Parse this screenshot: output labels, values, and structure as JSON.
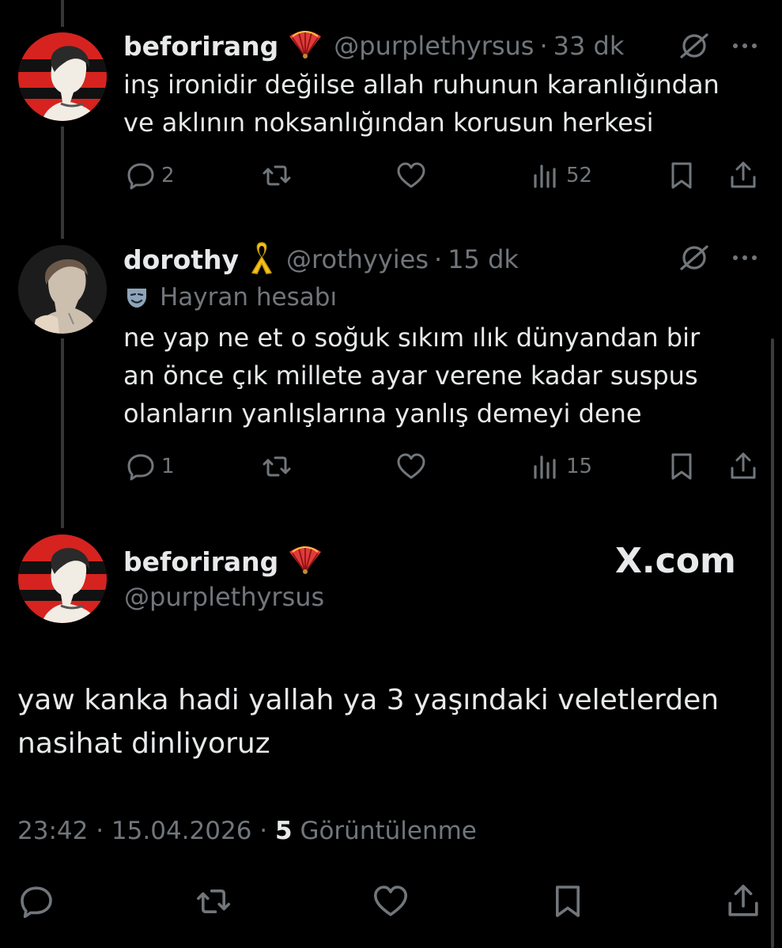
{
  "reply1": {
    "display_name": "beforirang",
    "emoji_icon": "folding-fan-icon",
    "handle": "@purplethyrsus",
    "separator": "·",
    "time": "33 dk",
    "text": "inş ironidir değilse allah ruhunun karanlığından\nve aklının noksanlığından korusun herkesi",
    "replies": "2",
    "views": "52"
  },
  "reply2": {
    "display_name": "dorothy",
    "emoji_icon": "yellow-ribbon-icon",
    "handle": "@rothyyies",
    "separator": "·",
    "time": "15 dk",
    "label_icon": "theater-mask-icon",
    "label": "Hayran hesabı",
    "text": "ne yap ne et o soğuk sıkım ılık dünyandan bir\nan önce çık millete ayar verene kadar suspus\nolanların yanlışlarına yanlış demeyi dene",
    "replies": "1",
    "views": "15"
  },
  "main_tweet": {
    "display_name": "beforirang",
    "emoji_icon": "folding-fan-icon",
    "handle": "@purplethyrsus",
    "watermark": "X.com",
    "text": "yaw kanka hadi yallah ya 3 yaşındaki veletlerden\nnasihat dinliyoruz",
    "time": "23:42",
    "separator": "·",
    "date": "15.04.2026",
    "views_count": "5",
    "views_label": "Görüntülenme"
  },
  "colors": {
    "background": "#000000",
    "text_primary": "#e7e9ea",
    "text_secondary": "#71767b",
    "thread_line": "#333639",
    "avatar_red": "#d6231f"
  }
}
